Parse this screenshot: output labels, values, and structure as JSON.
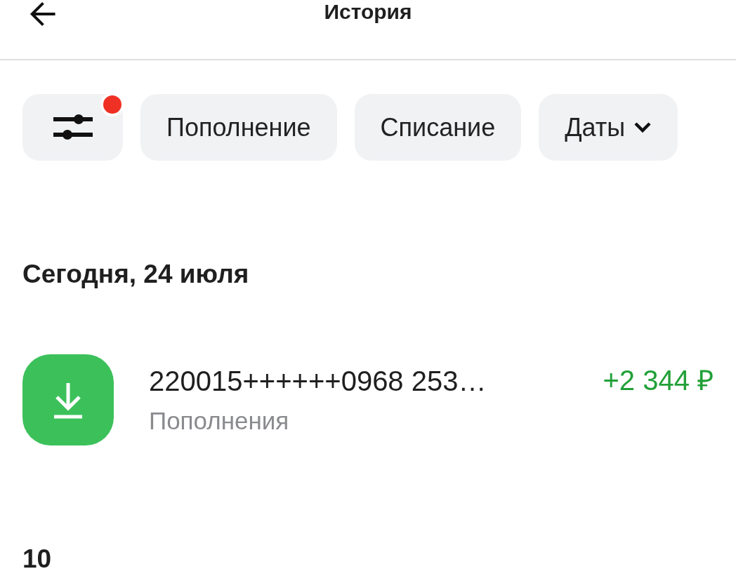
{
  "header": {
    "title": "История"
  },
  "filters": {
    "active": true,
    "chips": [
      {
        "label": "Пополнение",
        "kind": "plain",
        "selected": false
      },
      {
        "label": "Списание",
        "kind": "plain",
        "selected": false
      },
      {
        "label": "Даты",
        "kind": "dropdown",
        "selected": false
      }
    ]
  },
  "groups": [
    {
      "date": "Сегодня, 24 июля",
      "transactions": [
        {
          "title": "220015++++++0968 253…",
          "category": "Пополнения",
          "amount": "+2 344 ₽",
          "kind": "income"
        }
      ]
    },
    {
      "date": "10"
    }
  ]
}
